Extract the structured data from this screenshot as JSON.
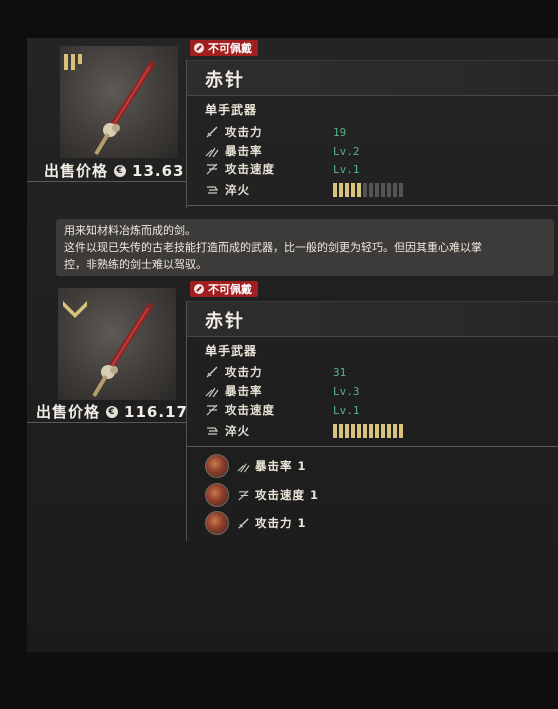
{
  "items": [
    {
      "badge": "不可佩戴",
      "name": "赤针",
      "type": "单手武器",
      "price_label": "出售价格",
      "price_value": "13.63",
      "tier_marker": "bars",
      "stats": [
        {
          "label": "攻击力",
          "value": "19",
          "icon": "sword-icon"
        },
        {
          "label": "暴击率",
          "value": "Lv.2",
          "icon": "crit-icon"
        },
        {
          "label": "攻击速度",
          "value": "Lv.1",
          "icon": "speed-icon"
        }
      ],
      "quench_label": "淬火",
      "quench_filled": 5,
      "quench_total": 12
    },
    {
      "badge": "不可佩戴",
      "name": "赤针",
      "type": "单手武器",
      "price_label": "出售价格",
      "price_value": "116.17",
      "tier_marker": "chevron",
      "stats": [
        {
          "label": "攻击力",
          "value": "31",
          "icon": "sword-icon"
        },
        {
          "label": "暴击率",
          "value": "Lv.3",
          "icon": "crit-icon"
        },
        {
          "label": "攻击速度",
          "value": "Lv.1",
          "icon": "speed-icon"
        }
      ],
      "quench_label": "淬火",
      "quench_filled": 12,
      "quench_total": 12,
      "perks": [
        {
          "label": "暴击率 1",
          "icon": "crit-icon"
        },
        {
          "label": "攻击速度 1",
          "icon": "speed-icon"
        },
        {
          "label": "攻击力 1",
          "icon": "sword-icon"
        }
      ]
    }
  ],
  "description": [
    "用来知材料冶炼而成的剑。",
    "这件以现已失传的古老技能打造而成的武器，比一般的剑更为轻巧。但因其重心难以掌",
    "控，非熟练的剑士难以驾驭。"
  ],
  "colors": {
    "stat_value": "#58b38a",
    "badge": "#a11f1f",
    "quench_on": "#d9c27e"
  }
}
